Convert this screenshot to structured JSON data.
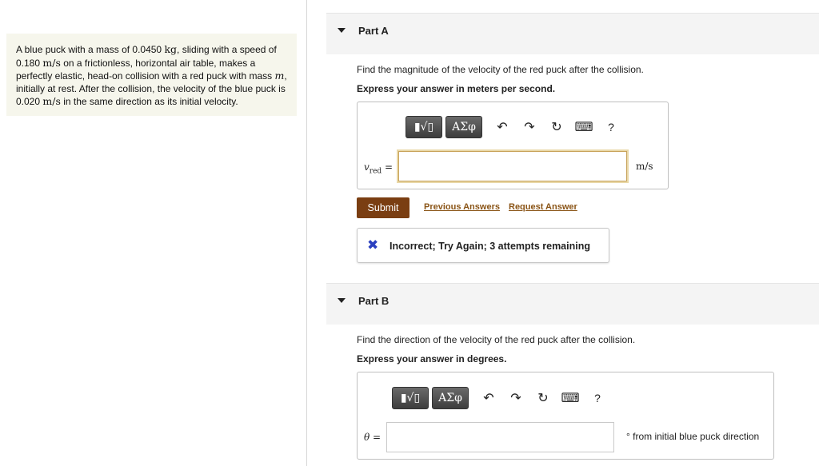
{
  "problem": {
    "text_1": "A blue puck with a mass of 0.0450 ",
    "unit_kg": "kg",
    "text_2": ", sliding with a speed of 0.180 ",
    "unit_ms_1": "m/s",
    "text_3": " on a frictionless, horizontal air table, makes a perfectly elastic, head-on collision with a red puck with mass ",
    "var_m": "m",
    "text_4": ", initially at rest. After the collision, the velocity of the blue puck is 0.020 ",
    "unit_ms_2": "m/s",
    "text_5": " in the same direction as its initial velocity."
  },
  "part_a": {
    "title": "Part A",
    "question": "Find the magnitude of  the velocity of the red puck after the collision.",
    "instruction": "Express your answer in meters per second.",
    "toolbar": {
      "template_glyph": "▮√▯",
      "greek_label": "ΑΣφ",
      "undo": "↶",
      "redo": "↷",
      "reset": "↻",
      "keyboard": "⌨",
      "help": "?"
    },
    "var_symbol": "v",
    "var_subscript": "red",
    "equals": " =",
    "input_value": "",
    "unit": "m/s",
    "submit_label": "Submit",
    "previous_answers": "Previous Answers",
    "request_answer": "Request Answer",
    "feedback_icon": "✖",
    "feedback_text": "Incorrect; Try Again; 3 attempts remaining"
  },
  "part_b": {
    "title": "Part B",
    "question": "Find the direction of the velocity of the red puck after the collision.",
    "instruction": "Express your answer in degrees.",
    "toolbar": {
      "template_glyph": "▮√▯",
      "greek_label": "ΑΣφ",
      "undo": "↶",
      "redo": "↷",
      "reset": "↻",
      "keyboard": "⌨",
      "help": "?"
    },
    "var_symbol": "θ",
    "equals": " =",
    "input_value": "",
    "unit": "° from initial blue puck direction"
  }
}
